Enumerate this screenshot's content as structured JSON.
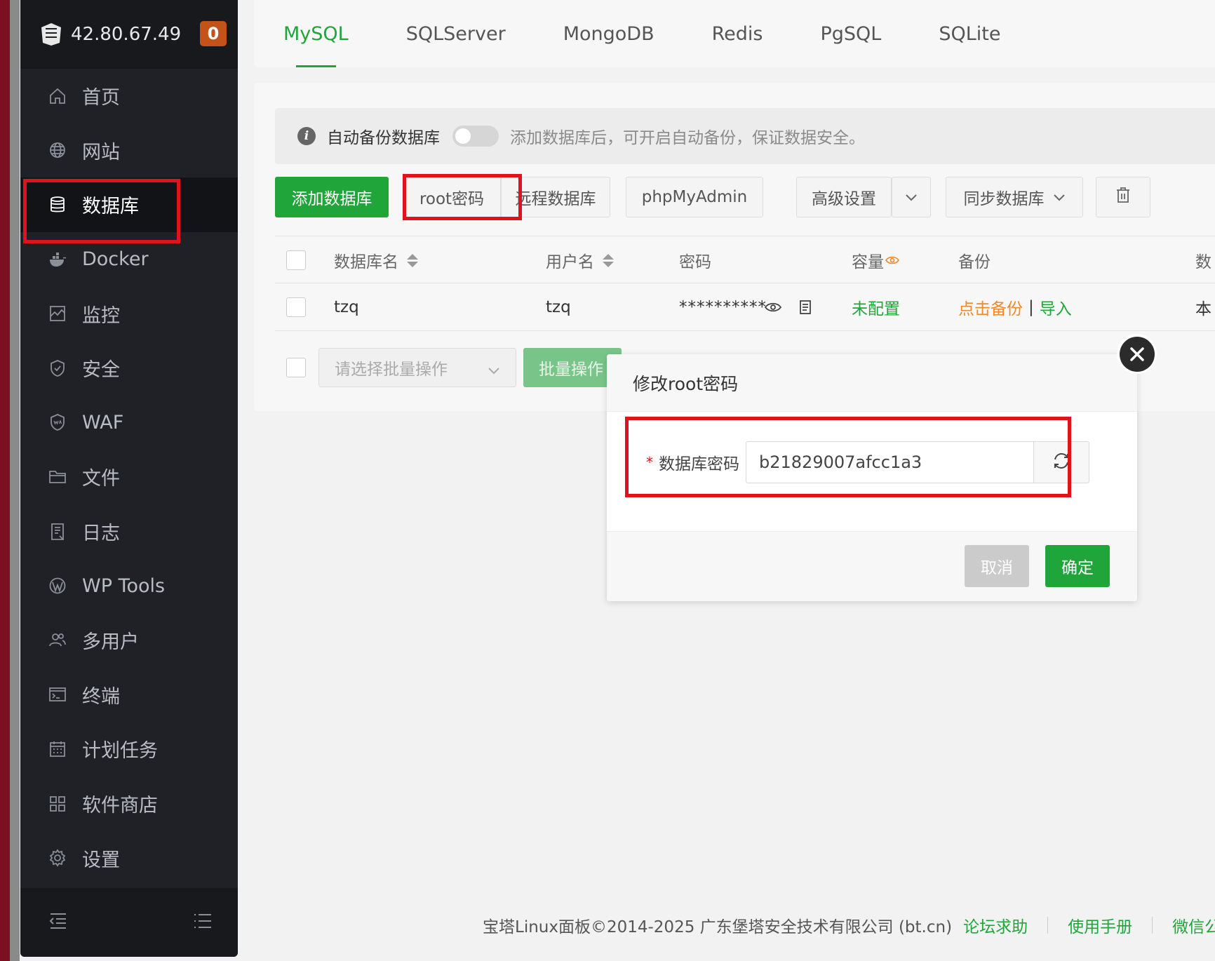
{
  "sidebar": {
    "server_ip": "42.80.67.49",
    "badge_count": "0",
    "items": [
      {
        "label": "首页",
        "icon": "home-icon"
      },
      {
        "label": "网站",
        "icon": "globe-icon"
      },
      {
        "label": "数据库",
        "icon": "database-icon"
      },
      {
        "label": "Docker",
        "icon": "docker-icon"
      },
      {
        "label": "监控",
        "icon": "monitor-icon"
      },
      {
        "label": "安全",
        "icon": "shield-icon"
      },
      {
        "label": "WAF",
        "icon": "waf-shield-icon"
      },
      {
        "label": "文件",
        "icon": "folder-icon"
      },
      {
        "label": "日志",
        "icon": "log-icon"
      },
      {
        "label": "WP Tools",
        "icon": "wordpress-icon"
      },
      {
        "label": "多用户",
        "icon": "users-icon"
      },
      {
        "label": "终端",
        "icon": "terminal-icon"
      },
      {
        "label": "计划任务",
        "icon": "calendar-icon"
      },
      {
        "label": "软件商店",
        "icon": "apps-grid-icon"
      },
      {
        "label": "设置",
        "icon": "gear-icon"
      }
    ],
    "active_item": "数据库"
  },
  "tabs": [
    "MySQL",
    "SQLServer",
    "MongoDB",
    "Redis",
    "PgSQL",
    "SQLite"
  ],
  "active_tab": "MySQL",
  "info_bar": {
    "label": "自动备份数据库",
    "hint": "添加数据库后，可开启自动备份，保证数据安全。"
  },
  "toolbar": {
    "add_db": "添加数据库",
    "root_password": "root密码",
    "remote_db": "远程数据库",
    "phpmyadmin": "phpMyAdmin",
    "advanced": "高级设置",
    "sync_db": "同步数据库"
  },
  "table": {
    "headers": {
      "name": "数据库名",
      "user": "用户名",
      "password": "密码",
      "capacity": "容量",
      "backup": "备份",
      "extra": "数"
    },
    "rows": [
      {
        "name": "tzq",
        "user": "tzq",
        "password": "**********",
        "capacity": "未配置",
        "backup_action": "点击备份",
        "backup_sep": "|",
        "import_action": "导入",
        "extra": "本"
      }
    ]
  },
  "batch": {
    "placeholder": "请选择批量操作",
    "button": "批量操作"
  },
  "modal": {
    "title": "修改root密码",
    "required_mark": "*",
    "field_label": "数据库密码",
    "password_value": "b21829007afcc1a3",
    "cancel": "取消",
    "confirm": "确定"
  },
  "footer": {
    "copyright": "宝塔Linux面板©2014-2025 广东堡塔安全技术有限公司 (bt.cn)",
    "links": [
      "论坛求助",
      "使用手册",
      "微信公众"
    ]
  },
  "colors": {
    "accent": "#20a53a",
    "highlight_box": "#e0131c",
    "sidebar_bg": "#1f2126",
    "badge": "#c4531a",
    "backup_link": "#f0882c"
  }
}
